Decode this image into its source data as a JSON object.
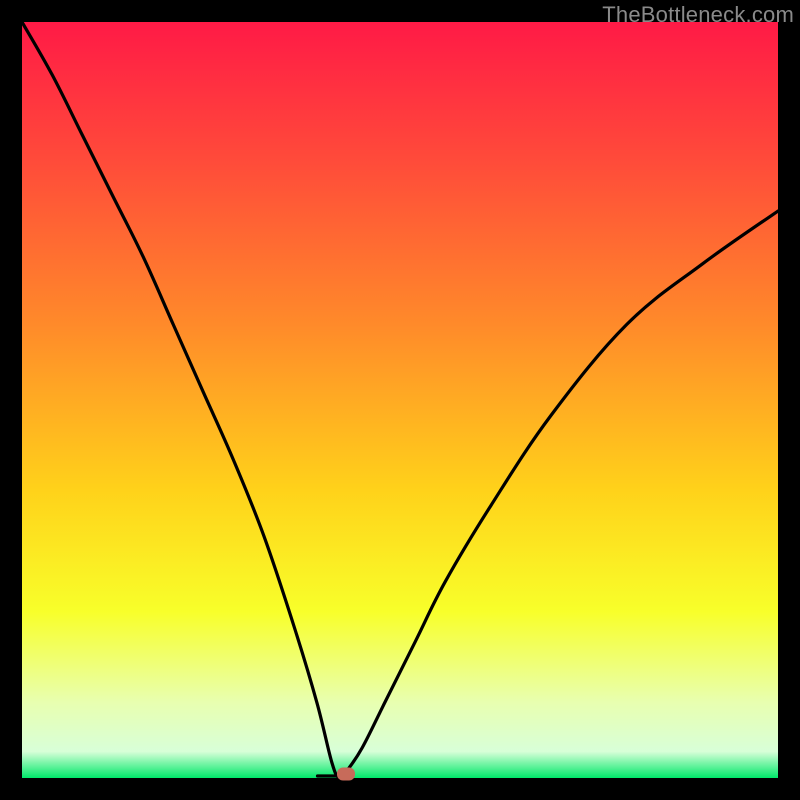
{
  "watermark": {
    "text": "TheBottleneck.com"
  },
  "marker": {
    "color": "#c76b5a"
  },
  "gradient": {
    "stops": [
      {
        "offset": 0.0,
        "color": "#ff1a46"
      },
      {
        "offset": 0.18,
        "color": "#ff4a3a"
      },
      {
        "offset": 0.4,
        "color": "#ff8a2a"
      },
      {
        "offset": 0.62,
        "color": "#ffd21a"
      },
      {
        "offset": 0.78,
        "color": "#f8ff2a"
      },
      {
        "offset": 0.9,
        "color": "#e8ffb0"
      },
      {
        "offset": 0.965,
        "color": "#d8ffd8"
      },
      {
        "offset": 1.0,
        "color": "#00e86a"
      }
    ]
  },
  "chart_data": {
    "type": "line",
    "title": "",
    "xlabel": "",
    "ylabel": "",
    "xlim": [
      0,
      100
    ],
    "ylim": [
      0,
      100
    ],
    "grid": false,
    "legend": false,
    "notes": "V-shaped bottleneck curve; minimum ~0 at x≈42; left branch from (0,100) steeply down; right branch rises to (100,~75).",
    "series": [
      {
        "name": "bottleneck-curve",
        "x": [
          0,
          4,
          8,
          12,
          16,
          20,
          24,
          28,
          32,
          36,
          39,
          41,
          42,
          43,
          45,
          48,
          52,
          56,
          62,
          70,
          80,
          90,
          100
        ],
        "y": [
          100,
          93,
          85,
          77,
          69,
          60,
          51,
          42,
          32,
          20,
          10,
          2,
          0,
          1,
          4,
          10,
          18,
          26,
          36,
          48,
          60,
          68,
          75
        ]
      }
    ],
    "marker_point": {
      "x": 42.8,
      "y": 0.5
    },
    "background": "vertical heat gradient red→orange→yellow→green"
  }
}
